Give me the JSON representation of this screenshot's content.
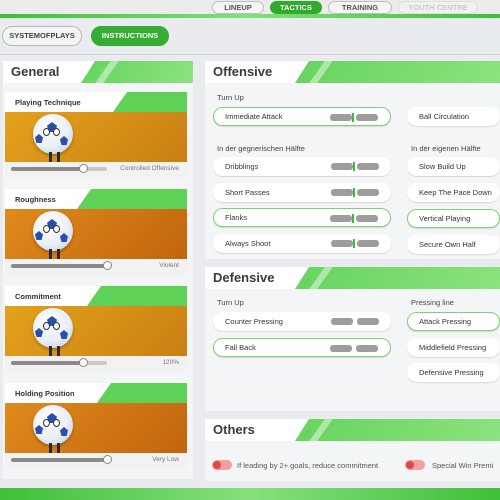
{
  "top_tabs": [
    {
      "label": "LINEUP",
      "active": false
    },
    {
      "label": "TACTICS",
      "active": true
    },
    {
      "label": "TRAINING",
      "active": false
    },
    {
      "label": "YOUTH CENTRE",
      "active": false
    }
  ],
  "sub_tabs": [
    {
      "label": "SYSTEMOFPLAYS",
      "active": false
    },
    {
      "label": "INSTRUCTIONS",
      "active": true
    }
  ],
  "general": {
    "title": "General",
    "cards": [
      {
        "label": "Playing Technique",
        "value_text": "Controlled Offensive",
        "level": 0.75
      },
      {
        "label": "Roughness",
        "value_text": "Violent",
        "level": 1.0
      },
      {
        "label": "Commitment",
        "value_text": "120%",
        "level": 0.75
      },
      {
        "label": "Holding Position",
        "value_text": "Very Low",
        "level": 1.0
      }
    ]
  },
  "offensive": {
    "title": "Offensive",
    "turn_up_label": "Turn Up",
    "turn_up_items": [
      {
        "label": "Immediate Attack",
        "selected": true,
        "bars": true
      },
      {
        "label": "Ball Circulation",
        "selected": false,
        "bars": false
      }
    ],
    "opp_half_label": "In der gegnerischen Hälfte",
    "opp_half_items": [
      {
        "label": "Dribblings",
        "selected": false
      },
      {
        "label": "Short Passes",
        "selected": false
      },
      {
        "label": "Flanks",
        "selected": true
      },
      {
        "label": "Always Shoot",
        "selected": false
      }
    ],
    "own_half_label": "In der eigenen Hälfte",
    "own_half_items": [
      {
        "label": "Slow Build Up",
        "selected": false
      },
      {
        "label": "Keep The Pace Down",
        "selected": false
      },
      {
        "label": "Vertical Playing",
        "selected": true
      },
      {
        "label": "Secure Own Half",
        "selected": false
      }
    ]
  },
  "defensive": {
    "title": "Defensive",
    "turn_up_label": "Turn Up",
    "turn_up_items": [
      {
        "label": "Counter Pressing",
        "selected": false
      },
      {
        "label": "Fall Back",
        "selected": true
      }
    ],
    "pressing_label": "Pressing line",
    "pressing_items": [
      {
        "label": "Attack Pressing",
        "selected": true
      },
      {
        "label": "Middlefield Pressing",
        "selected": false
      },
      {
        "label": "Defensive Pressing",
        "selected": false
      }
    ]
  },
  "others": {
    "title": "Others",
    "toggles": [
      {
        "label": "If leading by 2+ goals, reduce commitment",
        "on": false
      },
      {
        "label": "Special Win Premi",
        "on": false
      }
    ]
  },
  "colors": {
    "accent": "#35ad33",
    "toggle_off": "#e34848"
  }
}
